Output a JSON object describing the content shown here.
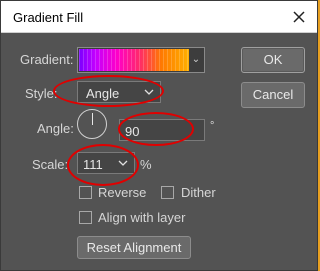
{
  "window": {
    "title": "Gradient Fill"
  },
  "fields": {
    "gradient_label": "Gradient:",
    "style_label": "Style:",
    "style_value": "Angle",
    "angle_label": "Angle:",
    "angle_value": "90",
    "angle_unit": "°",
    "scale_label": "Scale:",
    "scale_value": "111",
    "scale_unit": "%"
  },
  "options": {
    "reverse_label": "Reverse",
    "dither_label": "Dither",
    "align_label": "Align with layer"
  },
  "buttons": {
    "ok": "OK",
    "cancel": "Cancel",
    "reset_alignment": "Reset Alignment"
  },
  "colors": {
    "annotation": "#e00000",
    "dialog_bg": "#535353"
  }
}
